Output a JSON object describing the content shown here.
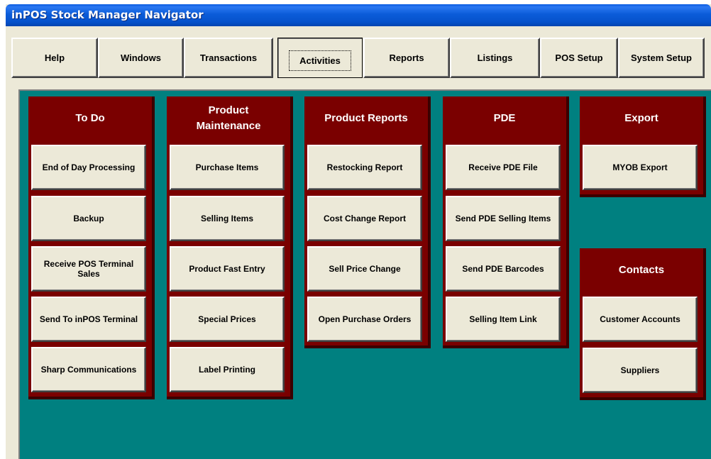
{
  "window": {
    "title": "inPOS Stock Manager Navigator"
  },
  "toolbar": {
    "buttons": [
      {
        "label": "Help"
      },
      {
        "label": "Windows"
      },
      {
        "label": "Transactions"
      },
      {
        "label": "Activities",
        "active": true
      },
      {
        "label": "Reports"
      },
      {
        "label": "Listings"
      },
      {
        "label": "POS Setup"
      },
      {
        "label": "System Setup"
      }
    ]
  },
  "groups": {
    "todo": {
      "title": "To Do",
      "items": [
        "End of Day Processing",
        "Backup",
        "Receive POS Terminal Sales",
        "Send To inPOS Terminal",
        "Sharp Communications"
      ]
    },
    "product_maintenance": {
      "title": "Product\nMaintenance",
      "items": [
        "Purchase Items",
        "Selling Items",
        "Product Fast Entry",
        "Special Prices",
        "Label Printing"
      ]
    },
    "product_reports": {
      "title": "Product Reports",
      "items": [
        "Restocking Report",
        "Cost Change Report",
        "Sell Price Change",
        "Open Purchase Orders"
      ]
    },
    "pde": {
      "title": "PDE",
      "items": [
        "Receive PDE File",
        "Send PDE Selling Items",
        "Send PDE Barcodes",
        "Selling Item Link"
      ]
    },
    "export": {
      "title": "Export",
      "items": [
        "MYOB Export"
      ]
    },
    "contacts": {
      "title": "Contacts",
      "items": [
        "Customer Accounts",
        "Suppliers"
      ]
    }
  },
  "colors": {
    "titlebar": "#0b5cd9",
    "panel_background": "#008080",
    "group_background": "#7a0000",
    "button_face": "#ece9d8"
  }
}
